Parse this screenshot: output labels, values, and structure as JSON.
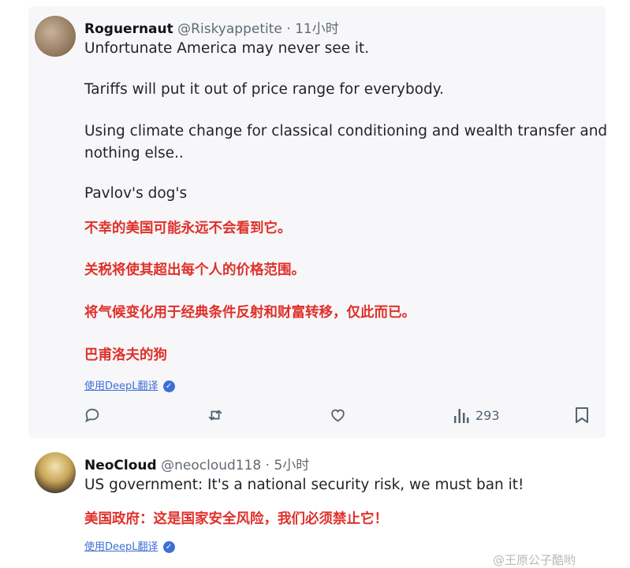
{
  "tweet1": {
    "username": "Roguernaut",
    "handle": "@Riskyappetite",
    "sep": " · ",
    "time": "11小时",
    "lines": [
      "Unfortunate America may never see it.",
      "Tariffs will put it out of price range for everybody.",
      "Using climate change for classical conditioning and wealth transfer and",
      "nothing else..",
      "Pavlov's dog's"
    ],
    "translation": [
      "不幸的美国可能永远不会看到它。",
      "关税将使其超出每个人的价格范围。",
      "将气候变化用于经典条件反射和财富转移，仅此而已。",
      "巴甫洛夫的狗"
    ],
    "translate_label": "使用DeepL翻译",
    "views": "293",
    "icons": [
      "reply-icon",
      "retweet-icon",
      "like-icon",
      "views-icon",
      "bookmark-icon"
    ]
  },
  "tweet2": {
    "username": "NeoCloud",
    "handle": "@neocloud118",
    "sep": " · ",
    "time": "5小时",
    "text": "US government: It's a national security risk, we must ban it!",
    "translation": "美国政府：这是国家安全风险，我们必须禁止它！",
    "translate_label": "使用DeepL翻译"
  },
  "watermark": "@王原公子酷哟",
  "colors": {
    "translation": "#e0302a",
    "link": "#3d6fd6",
    "card_bg": "#f7f7f9"
  }
}
